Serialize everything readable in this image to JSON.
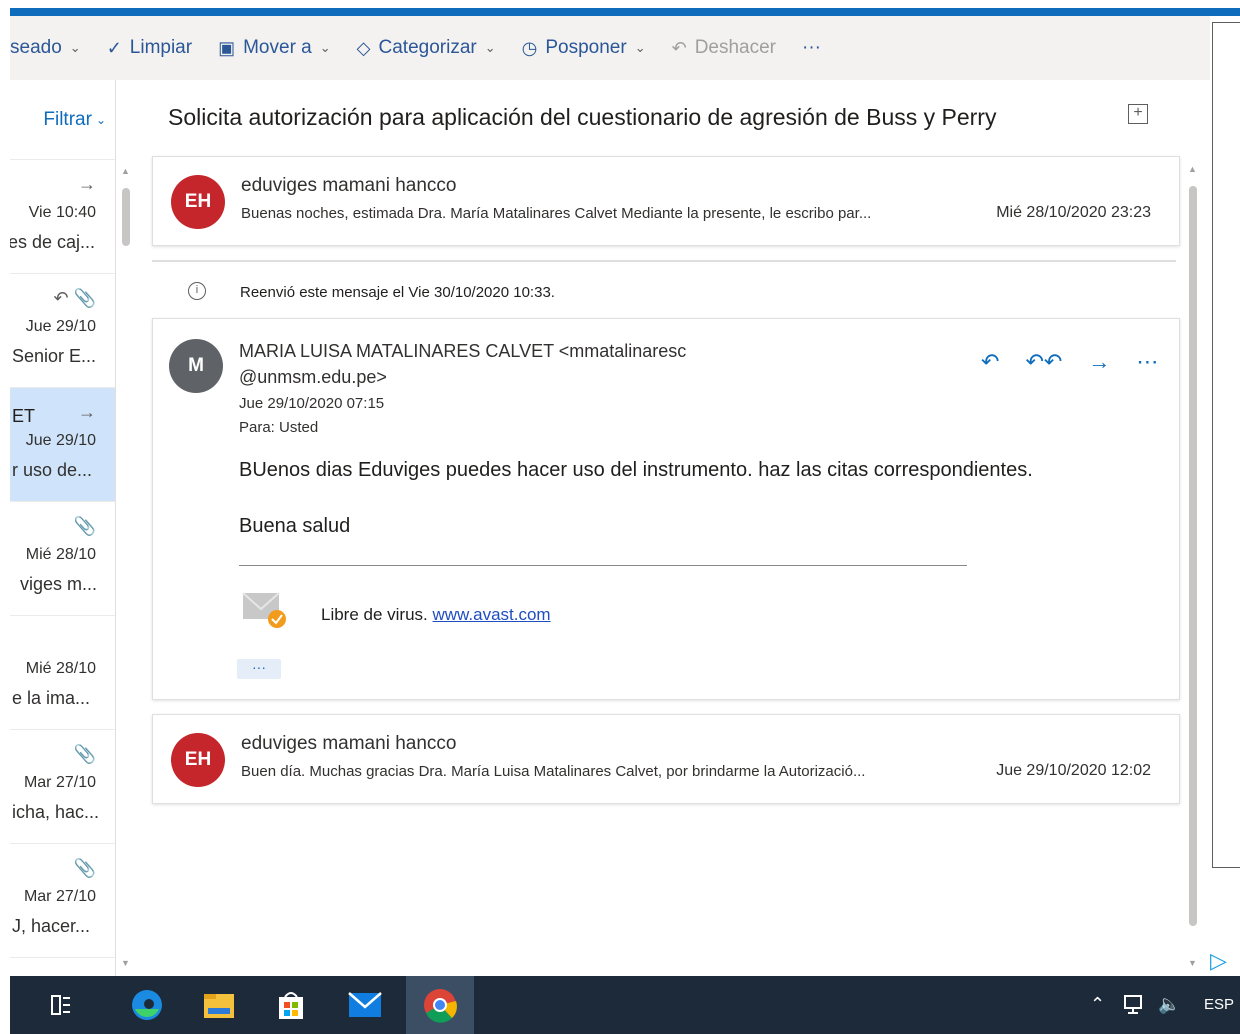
{
  "toolbar": {
    "items": [
      {
        "label": "seado",
        "icon": "",
        "chevron": true
      },
      {
        "label": "Limpiar",
        "icon": "broom-icon",
        "chevron": false
      },
      {
        "label": "Mover a",
        "icon": "move-folder-icon",
        "chevron": true
      },
      {
        "label": "Categorizar",
        "icon": "tag-icon",
        "chevron": true
      },
      {
        "label": "Posponer",
        "icon": "clock-icon",
        "chevron": true
      },
      {
        "label": "Deshacer",
        "icon": "undo-icon",
        "chevron": false
      },
      {
        "label": "···",
        "icon": "",
        "chevron": false
      }
    ]
  },
  "list": {
    "filter_label": "Filtrar",
    "items": [
      {
        "lead": "",
        "icons": "→",
        "date": "Vie 10:40",
        "snippet": "es de caj...",
        "selected": false
      },
      {
        "lead": "",
        "icons": "↶ 📎",
        "date": "Jue 29/10",
        "snippet": "Senior E...",
        "selected": false
      },
      {
        "lead": "ET",
        "icons": "→",
        "date": "Jue 29/10",
        "snippet": "r uso de...",
        "selected": true
      },
      {
        "lead": "",
        "icons": "📎",
        "date": "Mié 28/10",
        "snippet": "viges m...",
        "selected": false
      },
      {
        "lead": "",
        "icons": "",
        "date": "Mié 28/10",
        "snippet": "e la ima...",
        "selected": false
      },
      {
        "lead": "",
        "icons": "📎",
        "date": "Mar 27/10",
        "snippet": "icha, hac...",
        "selected": false
      },
      {
        "lead": "",
        "icons": "📎",
        "date": "Mar 27/10",
        "snippet": "J, hacer...",
        "selected": false
      }
    ]
  },
  "reading": {
    "subject": "Solicita autorización para aplicación del cuestionario de agresión de Buss y Perry",
    "msg1": {
      "initials": "EH",
      "sender": "eduviges mamani hancco",
      "preview": "Buenas noches, estimada Dra. María Matalinares Calvet Mediante la presente, le escribo par...",
      "date": "Mié 28/10/2020 23:23"
    },
    "forward_notice": "Reenvió este mensaje el Vie 30/10/2020 10:33.",
    "msg2": {
      "initials": "M",
      "sender_line1": "MARIA LUISA MATALINARES CALVET <mmatalinaresc",
      "sender_line2": "@unmsm.edu.pe>",
      "date": "Jue 29/10/2020 07:15",
      "to": "Para:  Usted",
      "body1": "BUenos dias Eduviges puedes hacer uso del instrumento. haz las citas correspondientes.",
      "body2": "Buena salud",
      "virus_text": "Libre de virus. ",
      "virus_link": "www.avast.com",
      "more": "···"
    },
    "msg3": {
      "initials": "EH",
      "sender": "eduviges mamani hancco",
      "preview": "Buen día. Muchas gracias Dra. María Luisa Matalinares Calvet, por brindarme la Autorizació...",
      "date": "Jue 29/10/2020 12:02"
    }
  },
  "taskbar": {
    "tray_lang": "ESP"
  },
  "colors": {
    "accent": "#0f6cbd",
    "avatar_red": "#c5262b",
    "avatar_gray": "#5f6368",
    "selected": "#cfe4fa",
    "taskbar": "#1c2a3a"
  }
}
